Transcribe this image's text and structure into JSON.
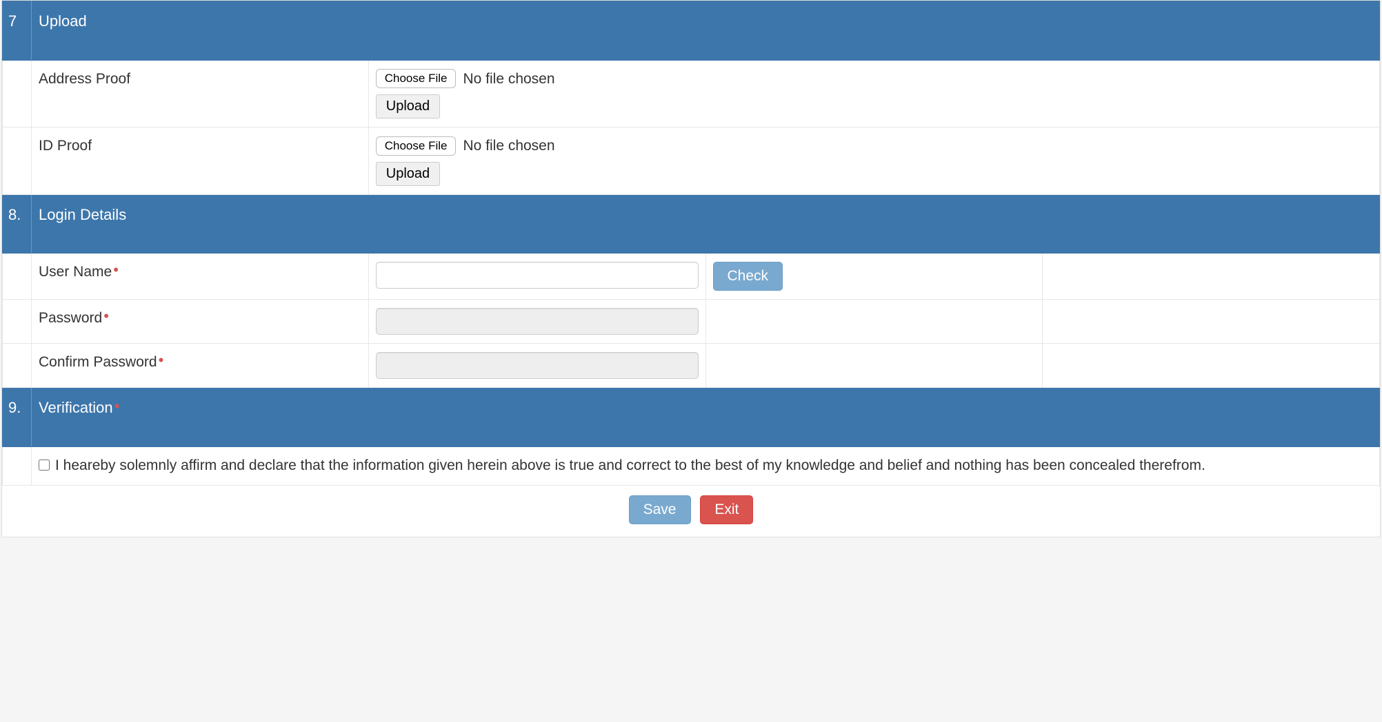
{
  "sections": {
    "upload": {
      "num": "7",
      "title": "Upload"
    },
    "login": {
      "num": "8.",
      "title": "Login Details"
    },
    "verify": {
      "num": "9.",
      "title": "Verification"
    }
  },
  "upload": {
    "rows": {
      "address_proof": {
        "label": "Address Proof",
        "choose": "Choose File",
        "status": "No file chosen",
        "upload": "Upload"
      },
      "id_proof": {
        "label": "ID Proof",
        "choose": "Choose File",
        "status": "No file chosen",
        "upload": "Upload"
      }
    }
  },
  "login": {
    "username": {
      "label": "User Name",
      "value": "",
      "check": "Check"
    },
    "password": {
      "label": "Password",
      "value": ""
    },
    "confirm": {
      "label": "Confirm Password",
      "value": ""
    }
  },
  "verification": {
    "declaration": "I heareby solemnly affirm and declare that the information given herein above is true and correct to the best of my knowledge and belief and nothing has been concealed therefrom."
  },
  "actions": {
    "save": "Save",
    "exit": "Exit"
  },
  "required_marker": "•"
}
